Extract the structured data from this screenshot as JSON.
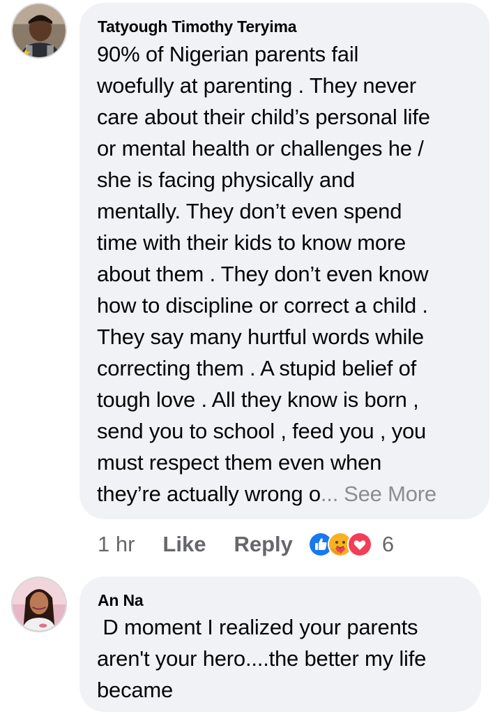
{
  "comments": [
    {
      "author": "Tatyough Timothy Teryima",
      "lines": [
        "90% of Nigerian parents fail",
        "woefully at parenting . They never",
        "care about their child’s personal life",
        "or mental health or challenges he /",
        "she is facing physically and",
        "mentally. They don’t even spend",
        "time with their kids to know more",
        "about them . They don’t even know",
        "how to discipline or correct a child .",
        "They say many hurtful words while",
        "correcting them . A stupid belief of",
        "tough love . All they know is born ,",
        "send you to school , feed you , you",
        "must respect them even when"
      ],
      "last_line": "they’re actually wrong o",
      "ellipsis": "...",
      "see_more": "See More",
      "time": "1 hr",
      "like_label": "Like",
      "reply_label": "Reply",
      "reaction_icons": [
        "like-reaction-icon",
        "care-reaction-icon",
        "love-reaction-icon"
      ],
      "reaction_count": "6"
    },
    {
      "author": "An Na",
      "lines": [
        " D moment I realized your parents",
        "aren't your hero....the better my life",
        "became"
      ]
    }
  ],
  "colors": {
    "bubble": "#f0f2f5",
    "text": "#050505",
    "secondary": "#65676b",
    "see_more": "#8a8d91",
    "like_blue": "#1877f2",
    "love_red": "#f33e58",
    "care_yellow": "#f7b125"
  }
}
